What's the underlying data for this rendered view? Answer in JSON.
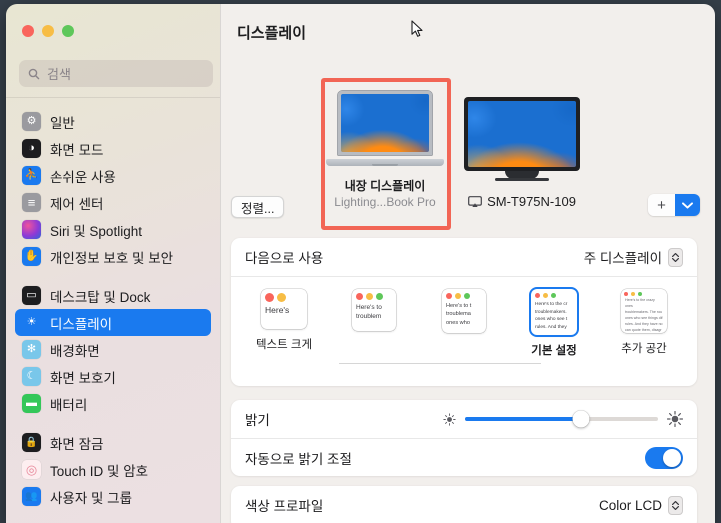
{
  "window": {
    "traffic_lights": [
      "close",
      "minimize",
      "zoom"
    ],
    "accent_color": "#1a7aef",
    "highlight_color": "#f26555"
  },
  "sidebar": {
    "search": {
      "placeholder": "검색",
      "value": "",
      "icon": "search-icon"
    },
    "groups": [
      {
        "items": [
          {
            "label": "일반",
            "icon": "gear-icon",
            "icon_bg": "#9a9a9f",
            "glyph": "⚙"
          },
          {
            "label": "화면 모드",
            "icon": "appearance-icon",
            "icon_bg": "#1d1d1f",
            "glyph": "◑"
          },
          {
            "label": "손쉬운 사용",
            "icon": "accessibility-icon",
            "icon_bg": "#1a7aef",
            "glyph": "⛹"
          },
          {
            "label": "제어 센터",
            "icon": "control-center-icon",
            "icon_bg": "#9a9a9f",
            "glyph": "≡"
          },
          {
            "label": "Siri 및 Spotlight",
            "icon": "siri-icon",
            "icon_bg": "#c23aa8",
            "glyph": "●"
          },
          {
            "label": "개인정보 보호 및 보안",
            "icon": "privacy-hand-icon",
            "icon_bg": "#1a7aef",
            "glyph": "✋"
          }
        ]
      },
      {
        "items": [
          {
            "label": "데스크탑 및 Dock",
            "icon": "desktop-dock-icon",
            "icon_bg": "#1d1d1f",
            "glyph": "▭"
          },
          {
            "label": "디스플레이",
            "icon": "display-brightness-icon",
            "icon_bg": "#1a7aef",
            "glyph": "☀",
            "active": true
          },
          {
            "label": "배경화면",
            "icon": "wallpaper-icon",
            "icon_bg": "#5ab8e8",
            "glyph": "✻"
          },
          {
            "label": "화면 보호기",
            "icon": "screensaver-icon",
            "icon_bg": "#5ab8e8",
            "glyph": "☾"
          },
          {
            "label": "배터리",
            "icon": "battery-icon",
            "icon_bg": "#34c759",
            "glyph": "▬"
          }
        ]
      },
      {
        "items": [
          {
            "label": "화면 잠금",
            "icon": "lock-screen-icon",
            "icon_bg": "#1d1d1f",
            "glyph": "ὑ2"
          },
          {
            "label": "Touch ID 및 암호",
            "icon": "touch-id-icon",
            "icon_bg": "#fdeff1",
            "glyph": "◎"
          },
          {
            "label": "사용자 및 그룹",
            "icon": "users-groups-icon",
            "icon_bg": "#1a7aef",
            "glyph": "὆5"
          }
        ]
      }
    ]
  },
  "main": {
    "title": "디스플레이",
    "arrange_button": "정렬...",
    "add_button": "+",
    "add_menu_icon": "chevron-down-icon",
    "displays": [
      {
        "name": "내장 디스플레이",
        "subtitle": "Lighting...Book Pro",
        "type": "laptop",
        "selected": true
      },
      {
        "name": "SM-T975N-109",
        "subtitle": "",
        "type": "monitor",
        "icon": "airplay-icon",
        "selected": false
      }
    ],
    "use_as": {
      "label": "다음으로 사용",
      "value": "주 디스플레이",
      "stepper_icon": "chevron-updown-icon"
    },
    "resolutions": [
      {
        "label": "텍스트 크게",
        "thumb_w": 46,
        "thumb_h": 40,
        "dot": 9,
        "font": 8.5,
        "lines": [
          "Here's"
        ],
        "selected": false
      },
      {
        "label": "",
        "thumb_w": 44,
        "thumb_h": 42,
        "dot": 7,
        "font": 6.5,
        "lines": [
          "Here's to",
          "troublem"
        ],
        "selected": false
      },
      {
        "label": "",
        "thumb_w": 44,
        "thumb_h": 44,
        "dot": 6,
        "font": 5.6,
        "lines": [
          "Here's to t",
          "troublema",
          "ones who"
        ],
        "selected": false
      },
      {
        "label": "기본 설정",
        "thumb_w": 46,
        "thumb_h": 46,
        "dot": 5,
        "font": 4.8,
        "lines": [
          "Here's to the cr",
          "troublemakers.",
          "ones who see t",
          "rules. And they"
        ],
        "selected": true
      },
      {
        "label": "추가 공간",
        "thumb_w": 46,
        "thumb_h": 44,
        "dot": 4,
        "font": 3.6,
        "lines": [
          "Here's to the crazy ones",
          "troublemakers. The rou",
          "ones who see things dif",
          "rules. And they have no",
          "can quote them, disagr",
          "them. About the only th",
          "Because they change th"
        ],
        "selected": false
      }
    ],
    "brightness": {
      "label": "밝기",
      "value_percent": 60,
      "low_icon": "brightness-low-icon",
      "high_icon": "brightness-high-icon"
    },
    "auto_brightness": {
      "label": "자동으로 밝기 조절",
      "enabled": true
    },
    "color_profile": {
      "label": "색상 프로파일",
      "value": "Color LCD",
      "stepper_icon": "chevron-updown-icon"
    }
  }
}
